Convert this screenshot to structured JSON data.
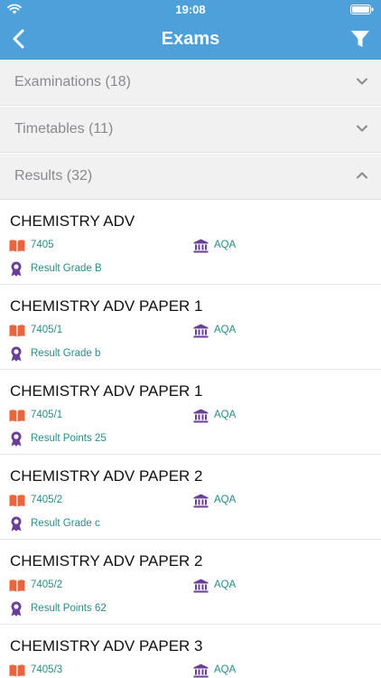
{
  "status_bar": {
    "time": "19:08"
  },
  "nav": {
    "title": "Exams"
  },
  "sections": [
    {
      "label": "Examinations (18)",
      "expanded": false
    },
    {
      "label": "Timetables (11)",
      "expanded": false
    },
    {
      "label": "Results (32)",
      "expanded": true
    }
  ],
  "results": [
    {
      "title": "CHEMISTRY ADV",
      "code": "7405",
      "board": "AQA",
      "result": "Result Grade B"
    },
    {
      "title": "CHEMISTRY ADV PAPER 1",
      "code": "7405/1",
      "board": "AQA",
      "result": "Result Grade b"
    },
    {
      "title": "CHEMISTRY ADV PAPER 1",
      "code": "7405/1",
      "board": "AQA",
      "result": "Result Points 25"
    },
    {
      "title": "CHEMISTRY ADV PAPER 2",
      "code": "7405/2",
      "board": "AQA",
      "result": "Result Grade c"
    },
    {
      "title": "CHEMISTRY ADV PAPER 2",
      "code": "7405/2",
      "board": "AQA",
      "result": "Result Points 62"
    },
    {
      "title": "CHEMISTRY ADV PAPER 3",
      "code": "7405/3",
      "board": "AQA",
      "result": ""
    }
  ],
  "colors": {
    "nav_bar": "#4da0da",
    "section_bg": "#f1f1f2",
    "book_icon": "#e8663e",
    "institution_icon": "#6a3f9a",
    "award_icon": "#6a3f9a",
    "detail_text": "#2a8a8a"
  }
}
